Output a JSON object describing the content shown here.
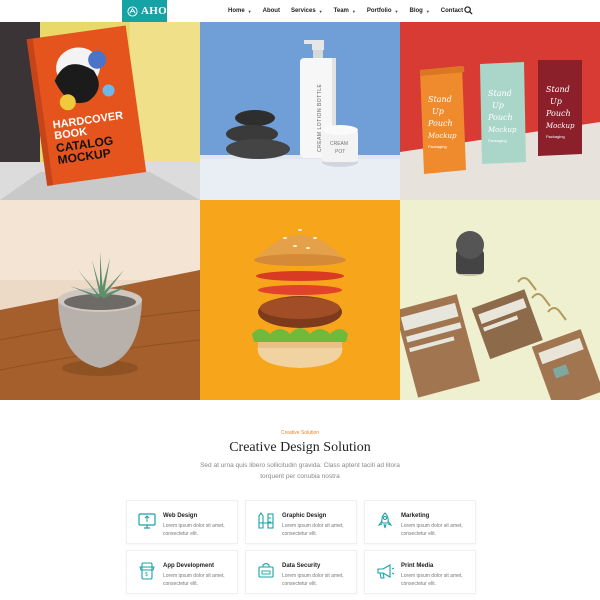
{
  "header": {
    "logo_text": "AHO",
    "nav": [
      {
        "label": "Home",
        "has_dropdown": true
      },
      {
        "label": "About",
        "has_dropdown": false
      },
      {
        "label": "Services",
        "has_dropdown": true
      },
      {
        "label": "Team",
        "has_dropdown": true
      },
      {
        "label": "Portfolio",
        "has_dropdown": true
      },
      {
        "label": "Blog",
        "has_dropdown": true
      },
      {
        "label": "Contact",
        "has_dropdown": false
      }
    ],
    "search_icon": "search-icon"
  },
  "gallery": {
    "book_text": [
      "HARDCOVER",
      "BOOK",
      "CATALOG",
      "MOCKUP"
    ],
    "bottle_text": "CREAM LOTION BOTTLE",
    "pot_text": [
      "CREAM",
      "POT"
    ],
    "pouch_text": [
      "Stand",
      "Up",
      "Pouch",
      "Mockup",
      "Packaging"
    ]
  },
  "section": {
    "kicker": "Creative Solution",
    "title": "Creative Design Solution",
    "description": "Sed at urna quis libero sollicitudin gravida. Class aptent taciti ad litora torquent per conubia nostra"
  },
  "services": [
    {
      "title": "Web Design",
      "text": "Lorem ipsum dolor sit amet, consectetur elit.",
      "icon": "web-design-icon"
    },
    {
      "title": "Graphic Design",
      "text": "Lorem ipsum dolor sit amet, consectetur elit.",
      "icon": "graphic-design-icon"
    },
    {
      "title": "Marketing",
      "text": "Lorem ipsum dolor sit amet, consectetur elit.",
      "icon": "rocket-icon"
    },
    {
      "title": "App Development",
      "text": "Lorem ipsum dolor sit amet, consectetur elit.",
      "icon": "mobile-store-icon"
    },
    {
      "title": "Data Security",
      "text": "Lorem ipsum dolor sit amet, consectetur elit.",
      "icon": "lock-icon"
    },
    {
      "title": "Print Media",
      "text": "Lorem ipsum dolor sit amet, consectetur elit.",
      "icon": "megaphone-icon"
    }
  ],
  "colors": {
    "brand": "#17a2a6",
    "kicker": "#e8852b"
  }
}
